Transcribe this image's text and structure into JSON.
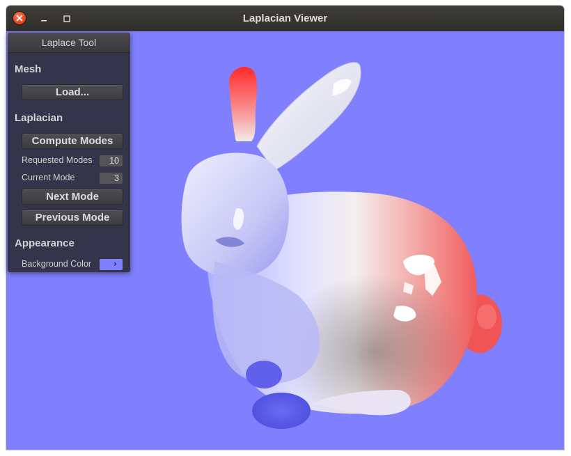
{
  "window": {
    "title": "Laplacian Viewer"
  },
  "viewport": {
    "background_color": "#8080ff",
    "model": "bunny",
    "colormap": [
      "#5c5cff",
      "#ffffff",
      "#ff3030"
    ]
  },
  "panel": {
    "title": "Laplace Tool",
    "mesh": {
      "section_label": "Mesh",
      "load_label": "Load..."
    },
    "laplacian": {
      "section_label": "Laplacian",
      "compute_label": "Compute Modes",
      "requested_modes_label": "Requested Modes",
      "requested_modes_value": "10",
      "current_mode_label": "Current Mode",
      "current_mode_value": "3",
      "next_label": "Next Mode",
      "previous_label": "Previous Mode"
    },
    "appearance": {
      "section_label": "Appearance",
      "background_color_label": "Background Color",
      "background_color_value": "#8080ff",
      "swatch_glyph": "›"
    }
  },
  "icons": {
    "close": "close-icon",
    "minimize": "minimize-icon",
    "maximize": "maximize-icon"
  }
}
